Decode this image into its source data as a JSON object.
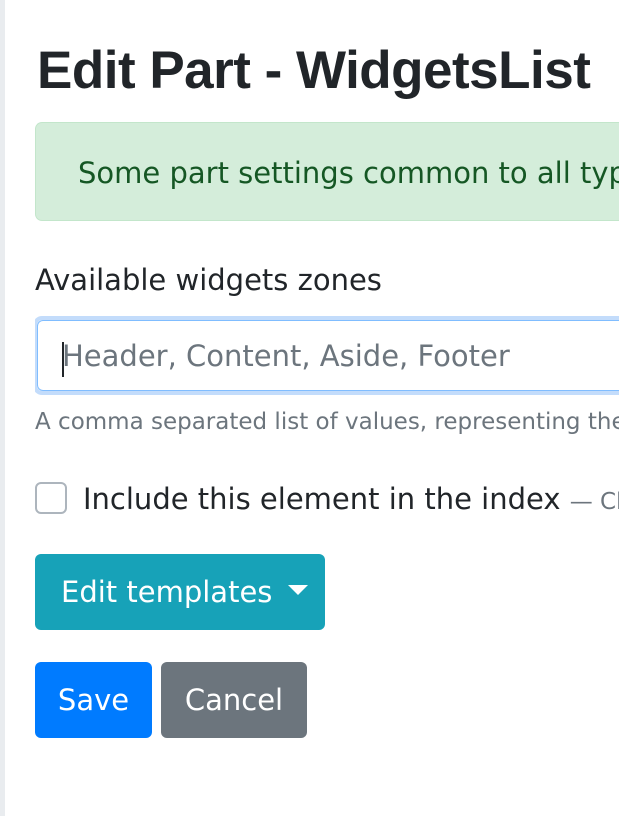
{
  "page": {
    "title": "Edit Part - WidgetsList"
  },
  "alert": {
    "text": "Some part settings common to all types are available",
    "color": "#155724",
    "background": "#d4edda"
  },
  "zones_field": {
    "label": "Available widgets zones",
    "value": "",
    "placeholder": "Header, Content, Aside, Footer",
    "hint": "A comma separated list of values, representing the available zones"
  },
  "index_checkbox": {
    "checked": false,
    "label": "Include this element in the index",
    "hint": "— Check"
  },
  "templates_button": {
    "label": "Edit templates",
    "icon": "caret-down-icon",
    "color": "#17a2b8"
  },
  "actions": {
    "save_label": "Save",
    "save_color": "#007bff",
    "cancel_label": "Cancel",
    "cancel_color": "#6c757d"
  }
}
